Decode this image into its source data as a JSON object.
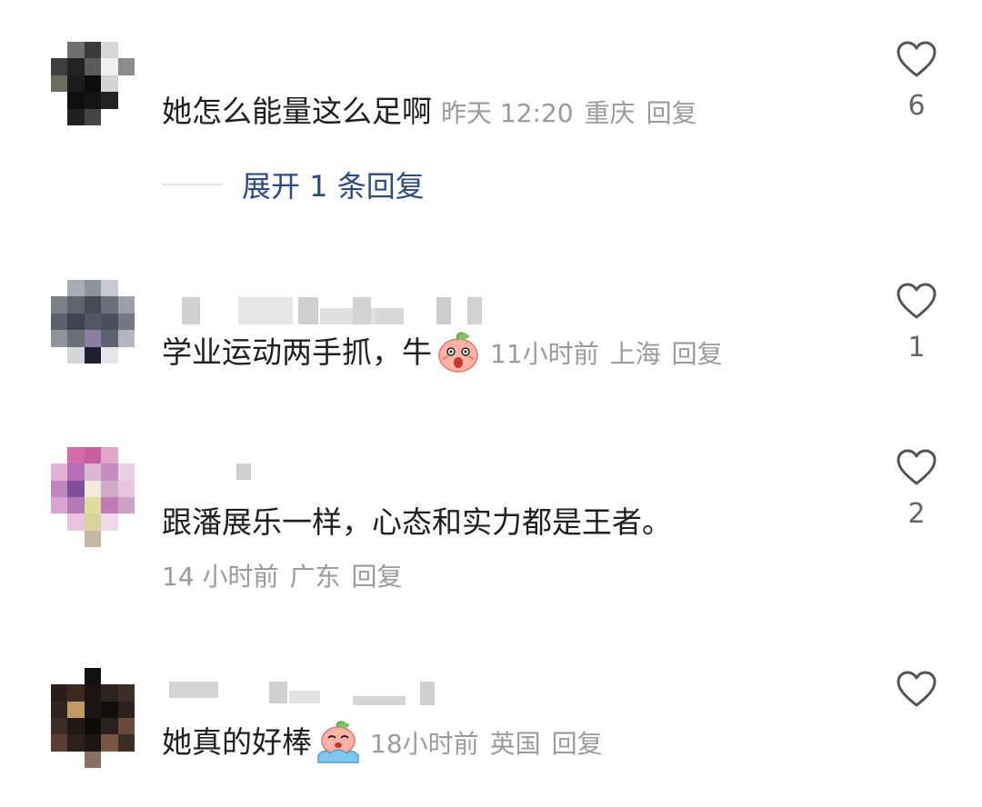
{
  "comments": [
    {
      "text": "她怎么能量这么足啊",
      "time": "昨天 12:20",
      "location": "重庆",
      "reply_label": "回复",
      "likes": "6",
      "expand_label": "展开 1 条回复"
    },
    {
      "text": "学业运动两手抓，牛",
      "time": "11小时前",
      "location": "上海",
      "reply_label": "回复",
      "likes": "1",
      "emoji": "shocked-peach-emoji"
    },
    {
      "text": "跟潘展乐一样，心态和实力都是王者。",
      "time": "14 小时前",
      "location": "广东",
      "reply_label": "回复",
      "likes": "2"
    },
    {
      "text": "她真的好棒",
      "time": "18小时前",
      "location": "英国",
      "reply_label": "回复",
      "emoji": "crying-peach-emoji"
    }
  ],
  "colors": {
    "text": "#1f1f1f",
    "meta": "#9b9b9b",
    "link": "#2b4b82",
    "icon": "#555555"
  },
  "icons": {
    "like": "heart-outline-icon"
  }
}
